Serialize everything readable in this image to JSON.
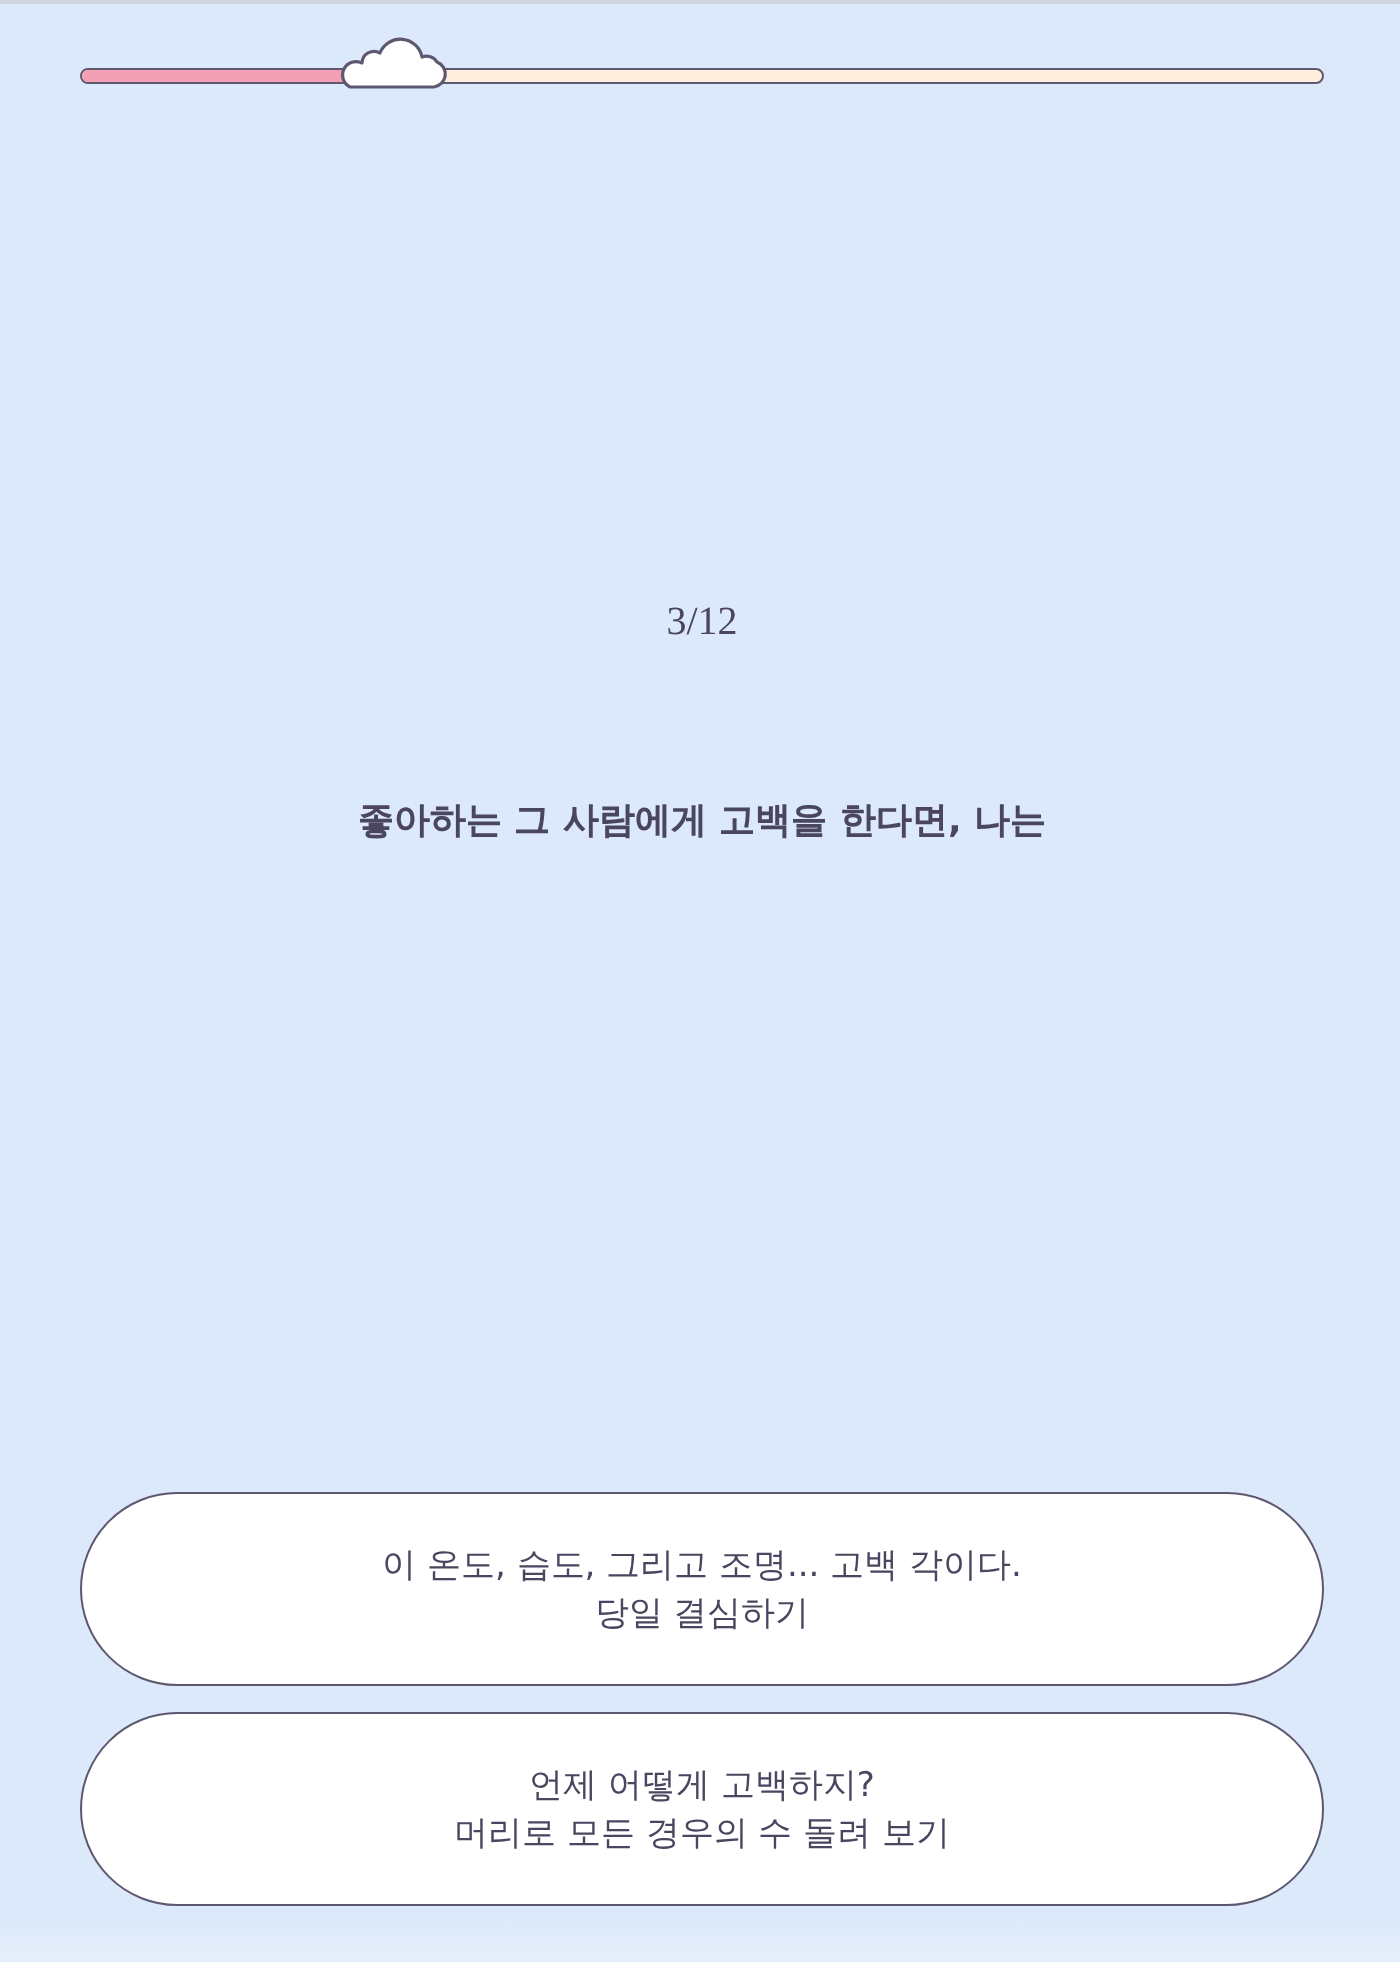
{
  "progress": {
    "level": 0.25
  },
  "counter": "3/12",
  "question": "좋아하는 그 사람에게 고백을 한다면, 나는",
  "options": [
    {
      "text": "이 온도, 습도, 그리고 조명... 고백 각이다.\n당일 결심하기"
    },
    {
      "text": "언제 어떻게 고백하지?\n머리로 모든 경우의 수 돌려 보기"
    }
  ]
}
